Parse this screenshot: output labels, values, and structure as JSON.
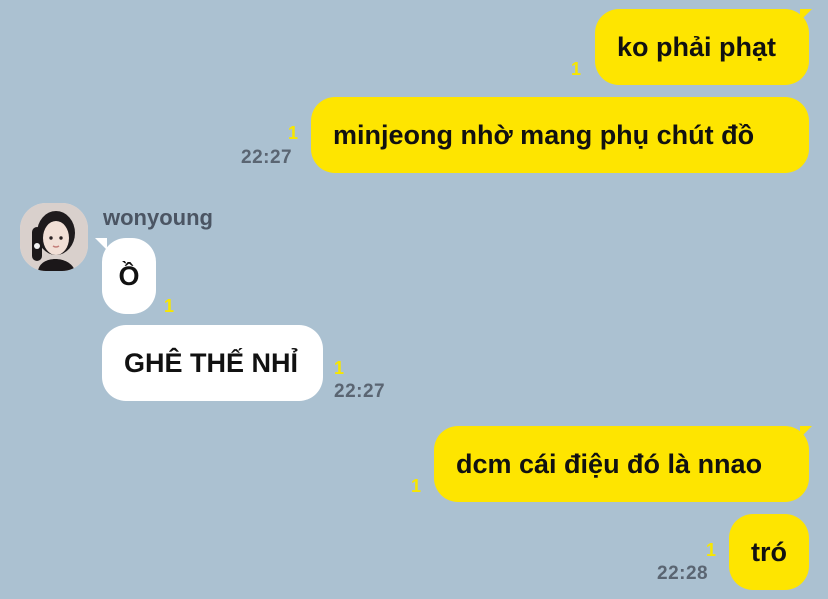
{
  "colors": {
    "background": "#abc1d1",
    "my_bubble": "#fee500",
    "their_bubble": "#ffffff",
    "read_count": "#f7e600",
    "time_text": "#5a6572"
  },
  "sender_name": "wonyoung",
  "messages": [
    {
      "from": "me",
      "text": "ko phải phạt",
      "read": "1",
      "time": ""
    },
    {
      "from": "me",
      "text": "minjeong nhờ mang phụ chút đồ",
      "read": "1",
      "time": "22:27"
    },
    {
      "from": "them",
      "text": "Ồ",
      "read": "1",
      "time": ""
    },
    {
      "from": "them",
      "text": "GHÊ THẾ NHỈ",
      "read": "1",
      "time": "22:27"
    },
    {
      "from": "me",
      "text": "dcm cái điệu đó là nnao",
      "read": "1",
      "time": ""
    },
    {
      "from": "me",
      "text": "tró",
      "read": "1",
      "time": "22:28"
    }
  ]
}
